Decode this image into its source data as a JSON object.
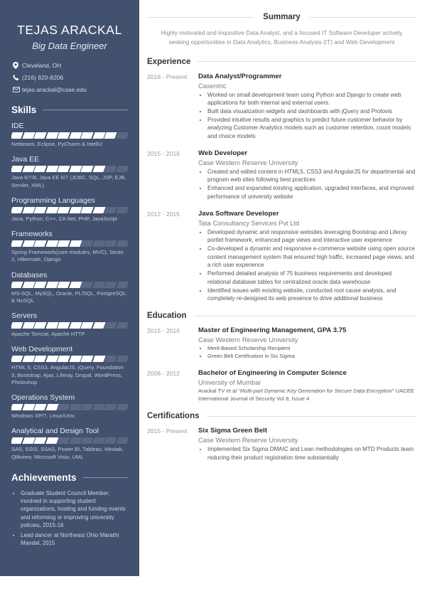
{
  "sidebar": {
    "name": "TEJAS ARACKAL",
    "role": "Big Data Engineer",
    "contacts": [
      {
        "icon": "location-pin-icon",
        "text": "Cleveland, OH"
      },
      {
        "icon": "phone-icon",
        "text": "(216) 820-8206"
      },
      {
        "icon": "envelope-icon",
        "text": "tejas.arackal@case.edu"
      }
    ],
    "skills_heading": "Skills",
    "skills": [
      {
        "name": "IDE",
        "filled": 9,
        "total": 10,
        "desc": "Netbeans, Eclipse, PyCharm & IntelliJ"
      },
      {
        "name": "Java EE",
        "filled": 8,
        "total": 10,
        "desc": "Java 6/7/8, Java EE 6/7 (JDBC, SQL, JSP, EJB, Servlet, XML)"
      },
      {
        "name": "Programming Languages",
        "filled": 8,
        "total": 10,
        "desc": "Java, Python, C++, C#.Net, PHP, JavaScript"
      },
      {
        "name": "Frameworks",
        "filled": 6,
        "total": 10,
        "desc": "Spring Framework(core modules, MVC), Struts 2, Hibernate, Django"
      },
      {
        "name": "Databases",
        "filled": 6,
        "total": 10,
        "desc": "MS-SQL, MySQL, Oracle, PL/SQL, PostgreSQL & NoSQL"
      },
      {
        "name": "Servers",
        "filled": 8,
        "total": 10,
        "desc": "Apache Tomcat, Apache HTTP"
      },
      {
        "name": "Web Development",
        "filled": 8,
        "total": 10,
        "desc": "HTML 5, CSS3, AngularJS, jQuery, Foundation 3, Bootstrap, Ajax, Liferay, Drupal, WordPress, Photoshop"
      },
      {
        "name": "Operations System",
        "filled": 4,
        "total": 10,
        "desc": "Windows XP/7, Linux/Unix"
      },
      {
        "name": "Analytical and Design Tool",
        "filled": 4,
        "total": 10,
        "desc": "SAS, SSIS, SSAS, Power BI, Tableau, Minitab, Qlikview, Microsoft Visio, UML"
      }
    ],
    "achievements_heading": "Achievements",
    "achievements": [
      "Graduate Student Council Member, involved in supporting student organizations, hosting and funding events and reforming or improving university policies, 2015-16",
      "Lead dancer at Northeast Ohio Marathi Mandal, 2015"
    ]
  },
  "main": {
    "summary": {
      "heading": "Summary",
      "text": "Highly motivated and inquisitive Data Analyst, and a focused IT Software Developer actively seeking opportunities in Data Analytics, Business Analysis (IT) and Web Development"
    },
    "experience": {
      "heading": "Experience",
      "entries": [
        {
          "date": "2016 - Present",
          "title": "Data Analyst/Programmer",
          "org": "Casentric",
          "bullets": [
            "Worked on small development team using Python and Django to create web applications for both internal and external users.",
            "Built data visualization widgets and dashboards with jQuery and Protovis",
            "Provided intuitive results and graphics to predict future customer behavior by analyzing Customer Analytics models such as customer retention, count models and choice models"
          ]
        },
        {
          "date": "2015 - 2016",
          "title": "Web Developer",
          "org": "Case Western Reserve University",
          "bullets": [
            "Created and edited content in HTML5, CSS3 and AngularJS for departmental and program web sites following best practices",
            "Enhanced and expanded existing application, upgraded interfaces, and improved performance of university website"
          ]
        },
        {
          "date": "2012 - 2015",
          "title": "Java Software Developer",
          "org": "Tata Consultancy Services Pvt Ltd",
          "bullets": [
            "Developed dynamic and responsive websites leveraging Bootstrap and Liferay portlet framework, enhanced page views and interactive user experience",
            "Co-developed a dynamic and responsive e-commerce website using open source content management system that ensured high traffic, increased page views, and a rich user experience",
            "Performed detailed analysis of 75 business requirements and developed relational database tables for centralized oracle data warehouse",
            "Identified issues with existing website, conducted root cause analysis, and completely re-designed its web presence to drive additional business"
          ]
        }
      ]
    },
    "education": {
      "heading": "Education",
      "entries": [
        {
          "date": "2015 - 2016",
          "title": "Master of Engineering Management, GPA 3.75",
          "org": "Case Western Reserve University",
          "bullets": [
            "Merit-Based Scholarship Recipient",
            "Green Belt Certification in Six Sigma"
          ]
        },
        {
          "date": "2008 - 2012",
          "title": "Bachelor of Engineering in Computer Science",
          "org": "University of Mumbai",
          "publication_prefix": "Arackal TV et al “",
          "publication_italic": "Multi-part Dynamic Key Generation for Secure Data Encryption",
          "publication_suffix": "” UACEE International Journal of Security Vol 8, Issue 4"
        }
      ]
    },
    "certifications": {
      "heading": "Certifications",
      "entries": [
        {
          "date": "2015 - Present",
          "title": "Six Sigma Green Belt",
          "org": "Case Western Reserve University",
          "bullets": [
            "Implemented Six Sigma DMAIC and Lean methodologies on MTD Products team reducing their product registration time substantially"
          ]
        }
      ]
    }
  },
  "colors": {
    "sidebar_bg": "#42516e",
    "skill_filled": "#ffffff",
    "skill_empty": "#5b6884",
    "rule": "#e0e0e0",
    "heading_text": "#333333"
  }
}
